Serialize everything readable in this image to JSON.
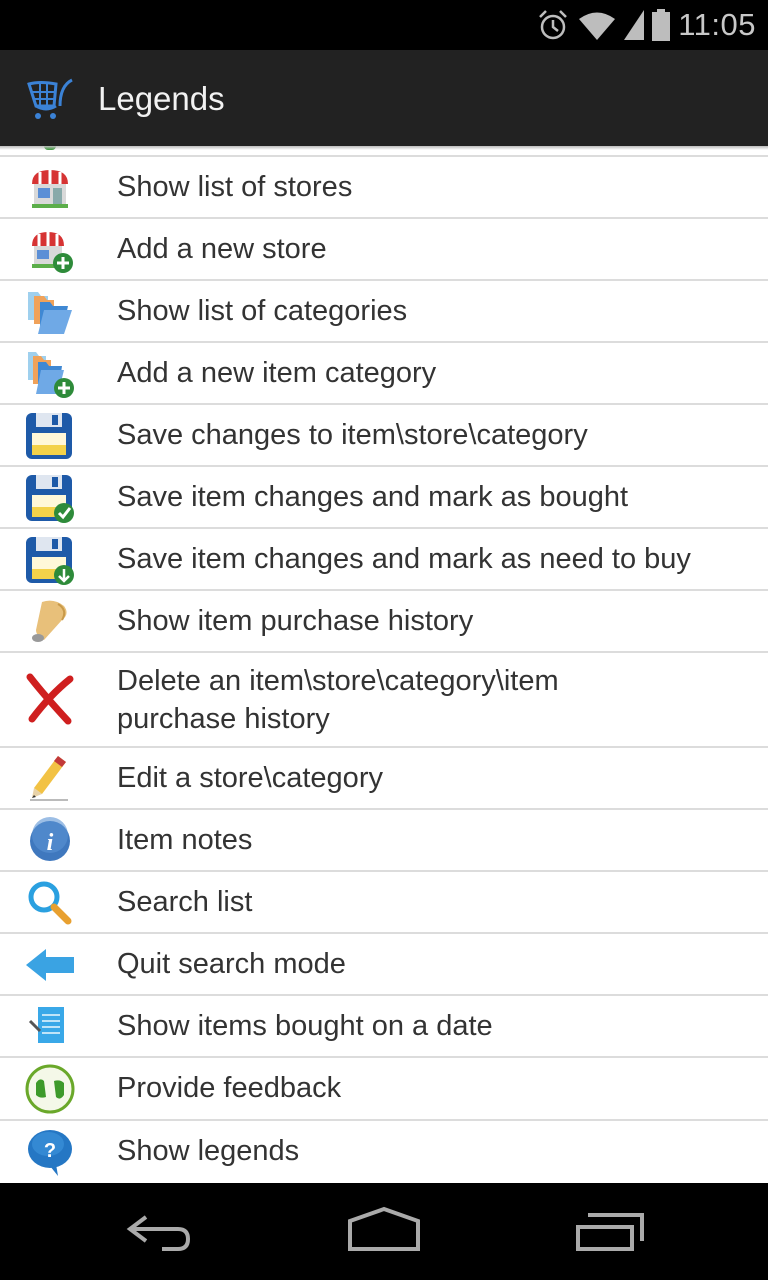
{
  "status_bar": {
    "time": "11:05",
    "icons": [
      "alarm-icon",
      "wifi-icon",
      "signal-icon",
      "battery-icon"
    ]
  },
  "action_bar": {
    "title": "Legends",
    "app_icon": "shopping-cart-icon"
  },
  "legends": [
    {
      "icon": "store-icon",
      "label": "Show list of stores"
    },
    {
      "icon": "store-add-icon",
      "label": "Add a new store"
    },
    {
      "icon": "folders-icon",
      "label": "Show list of categories"
    },
    {
      "icon": "folder-add-icon",
      "label": "Add a new item category"
    },
    {
      "icon": "save-icon",
      "label": "Save changes to item\\store\\category"
    },
    {
      "icon": "save-check-icon",
      "label": "Save item changes and mark as bought"
    },
    {
      "icon": "save-download-icon",
      "label": "Save item changes and mark as need to buy"
    },
    {
      "icon": "scroll-icon",
      "label": "Show item purchase history"
    },
    {
      "icon": "delete-x-icon",
      "label": "Delete an item\\store\\category\\item",
      "label2": "purchase history"
    },
    {
      "icon": "pencil-icon",
      "label": "Edit a store\\category"
    },
    {
      "icon": "info-icon",
      "label": "Item notes"
    },
    {
      "icon": "search-icon",
      "label": "Search list"
    },
    {
      "icon": "back-arrow-icon",
      "label": "Quit search mode"
    },
    {
      "icon": "list-date-icon",
      "label": "Show items bought on a date"
    },
    {
      "icon": "feedback-thumbs-icon",
      "label": "Provide feedback"
    },
    {
      "icon": "help-bubble-icon",
      "label": "Show legends"
    }
  ],
  "nav_bar": {
    "buttons": [
      "back-button",
      "home-button",
      "recents-button"
    ]
  }
}
